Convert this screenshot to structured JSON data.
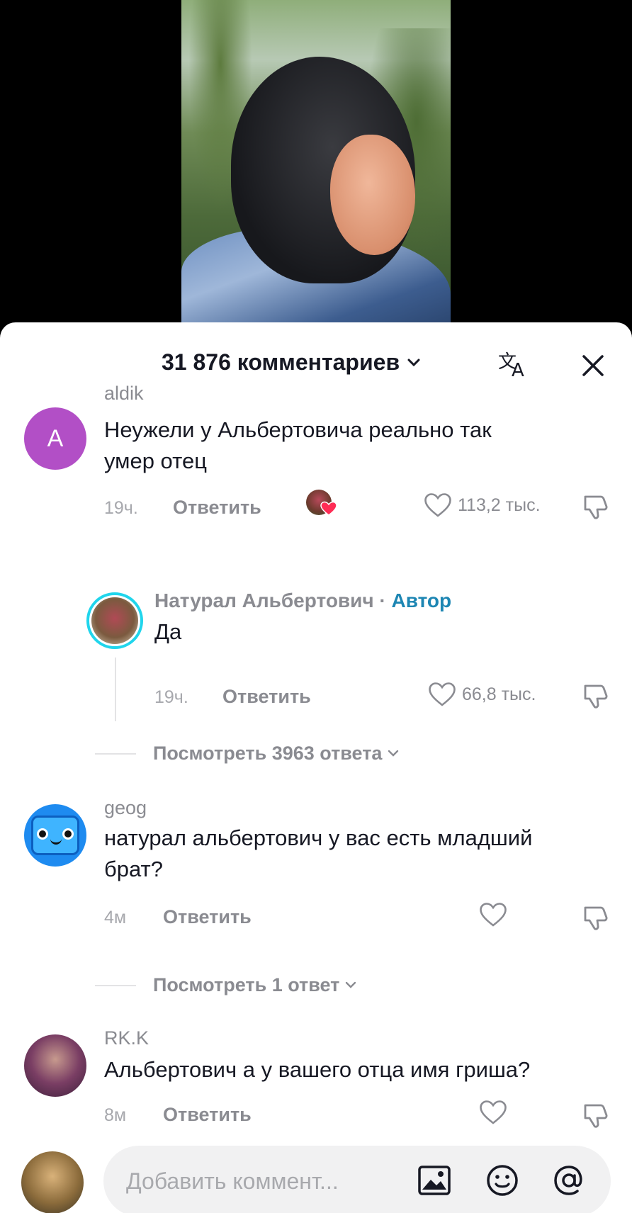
{
  "header": {
    "comment_count_label": "31 876 комментариев",
    "chevron": "⌄"
  },
  "comments": [
    {
      "username": "aldik",
      "avatar_letter": "A",
      "avatar_color": "#b24fc6",
      "text_line1": "Неужели у Альбертовича реально так",
      "text_line2": "умер отец",
      "time": "19ч.",
      "reply_label": "Ответить",
      "likes": "113,2 тыс."
    },
    {
      "username": "Натурал Альбертович",
      "separator": "·",
      "author_tag": "Автор",
      "text": "Да",
      "time": "19ч.",
      "reply_label": "Ответить",
      "likes": "66,8 тыс."
    },
    {
      "username": "geog",
      "avatar_color": "#1e8bf0",
      "text_line1": "натурал альбертович у вас есть младший",
      "text_line2": "брат?",
      "time": "4м",
      "reply_label": "Ответить",
      "likes": ""
    },
    {
      "username": "RK.K",
      "text": "Альбертович а у вашего отца имя гриша?",
      "time": "8м",
      "reply_label": "Ответить",
      "likes": ""
    }
  ],
  "view_replies": [
    {
      "label": "Посмотреть 3963 ответа"
    },
    {
      "label": "Посмотреть 1 ответ"
    }
  ],
  "input": {
    "placeholder": "Добавить коммент..."
  },
  "icons": {
    "translate": "translate-icon",
    "close": "close-icon",
    "heart": "heart-icon",
    "dislike": "dislike-icon",
    "image": "image-icon",
    "emoji": "emoji-icon",
    "mention": "at-icon"
  }
}
